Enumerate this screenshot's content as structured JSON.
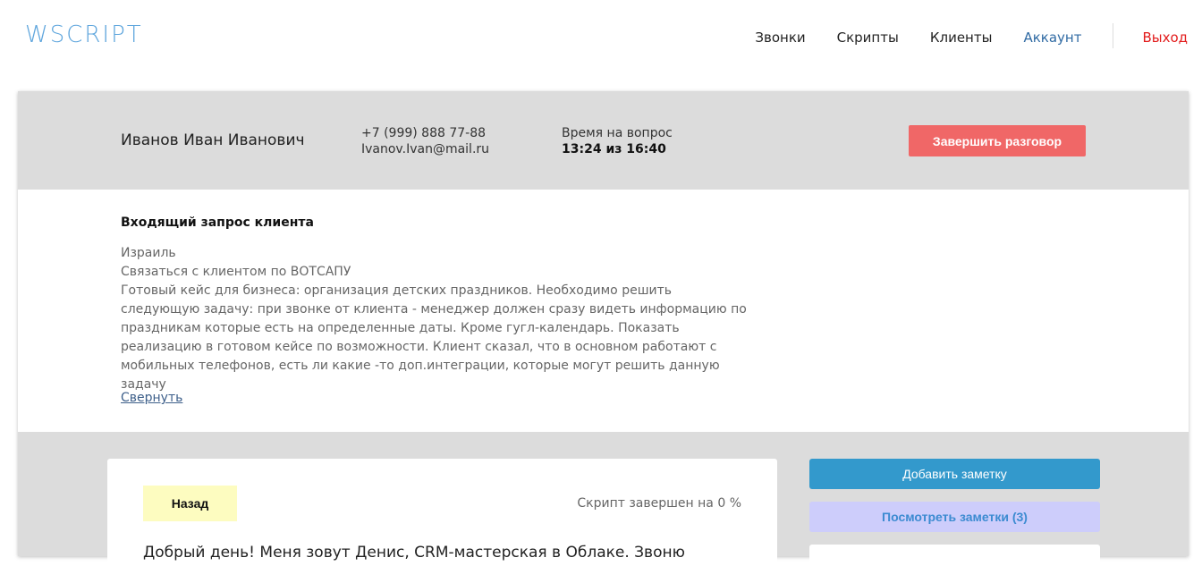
{
  "header": {
    "logo": "WSCRIPT",
    "nav": [
      {
        "label": "Звонки",
        "active": false
      },
      {
        "label": "Скрипты",
        "active": false
      },
      {
        "label": "Клиенты",
        "active": false
      },
      {
        "label": "Аккаунт",
        "active": true
      }
    ],
    "logout": "Выход"
  },
  "client": {
    "name": "Иванов Иван Иванович",
    "phone": "+7 (999) 888 77-88",
    "email": "Ivanov.Ivan@mail.ru",
    "time_label": "Время на вопрос",
    "time_value": "13:24 из 16:40",
    "end_button": "Завершить разговор"
  },
  "request": {
    "title": "Входящий запрос клиента",
    "lines": [
      "Израиль",
      "Связаться с клиентом по ВОТСАПУ",
      "Готовый кейс для бизнеса: организация детских праздников. Необходимо решить следующую задачу: при звонке от клиента - менеджер должен сразу видеть информацию по праздникам которые есть на определенные даты. Кроме гугл-календарь. Показать реализацию в готовом кейсе по возможности. Клиент сказал, что в основном работают с мобильных телефонов, есть ли какие -то доп.интеграции, которые могут решить данную задачу"
    ],
    "collapse": "Свернуть"
  },
  "script": {
    "back": "Назад",
    "progress": "Скрипт завершен на 0 %",
    "text": "Добрый день! Меня зовут Денис, CRM-мастерская в Облаке. Звоню"
  },
  "sidebar": {
    "add_note": "Добавить заметку",
    "view_notes": "Посмотреть заметки (3)"
  },
  "colors": {
    "logo": "#5fa6dd",
    "active_nav": "#2f6aa3",
    "logout": "#e21b1b",
    "end_button": "#f06767",
    "back_button": "#fdfcc0",
    "add_note": "#3399cc",
    "view_notes": "#cdcdfb"
  }
}
